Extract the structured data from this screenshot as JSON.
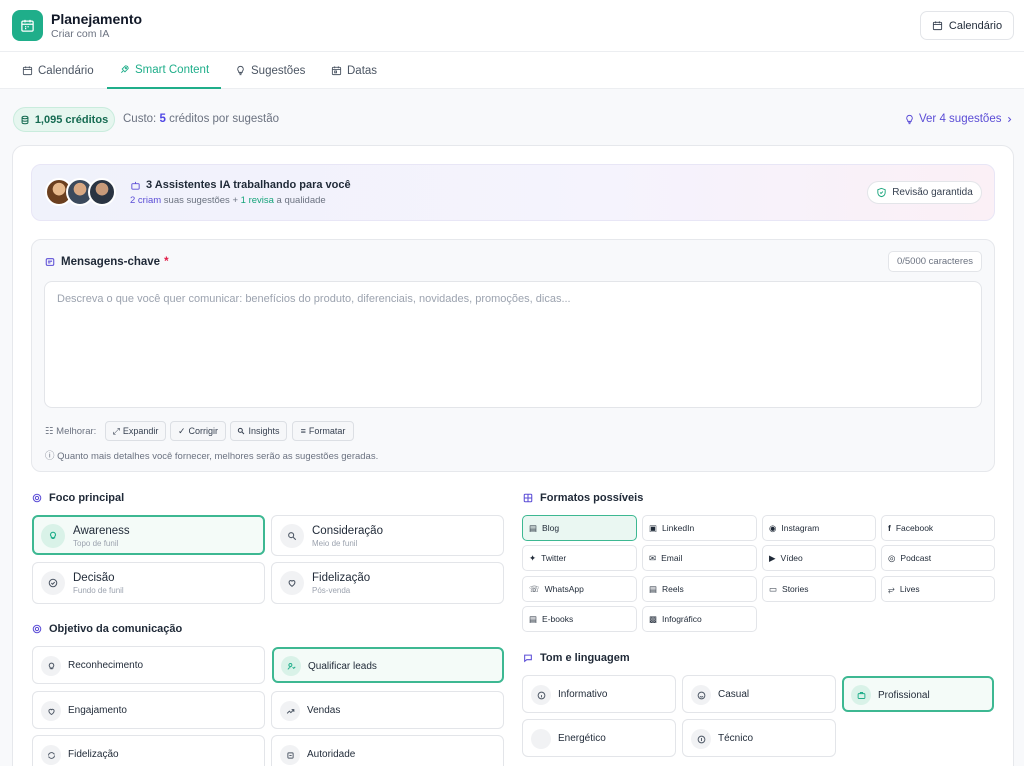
{
  "header": {
    "title": "Planejamento",
    "subtitle": "Criar com IA",
    "calendar_button": "Calendário"
  },
  "tabs": [
    {
      "label": "Calendário",
      "icon": "calendar-icon"
    },
    {
      "label": "Smart Content",
      "icon": "rocket-icon",
      "active": true
    },
    {
      "label": "Sugestões",
      "icon": "lightbulb-icon"
    },
    {
      "label": "Datas",
      "icon": "calendar-date-icon"
    }
  ],
  "toolbar": {
    "credits": "1,095 créditos",
    "cost_prefix": "Custo:",
    "cost_value": "5",
    "cost_suffix": "créditos por sugestão",
    "see_suggestions": "Ver 4 sugestões"
  },
  "banner": {
    "title": "3 Assistentes IA trabalhando para você",
    "create_count": "2 criam",
    "create_text": "suas sugestões +",
    "review_count": "1 revisa",
    "review_text": "a qualidade",
    "badge": "Revisão garantida"
  },
  "messages": {
    "title": "Mensagens-chave",
    "required_mark": "*",
    "counter": "0/5000 caracteres",
    "placeholder": "Descreva o que você quer comunicar: benefícios do produto, diferenciais, novidades, promoções, dicas...",
    "value": "",
    "improve_label": "Melhorar:",
    "improve_actions": [
      "Expandir",
      "Corrigir",
      "Insights",
      "Formatar"
    ],
    "hint": "Quanto mais detalhes você fornecer, melhores serão as sugestões geradas."
  },
  "focus": {
    "title": "Foco principal",
    "options": [
      {
        "title": "Awareness",
        "subtitle": "Topo de funil",
        "icon": "lightbulb-icon",
        "selected": true
      },
      {
        "title": "Consideração",
        "subtitle": "Meio de funil",
        "icon": "search-icon",
        "selected": false
      },
      {
        "title": "Decisão",
        "subtitle": "Fundo de funil",
        "icon": "check-circle-icon",
        "selected": false
      },
      {
        "title": "Fidelização",
        "subtitle": "Pós-venda",
        "icon": "heart-icon",
        "selected": false
      }
    ]
  },
  "objective": {
    "title": "Objetivo da comunicação",
    "options": [
      {
        "label": "Reconhecimento",
        "icon": "lightbulb-icon",
        "selected": false
      },
      {
        "label": "Qualificar leads",
        "icon": "user-filter-icon",
        "selected": true
      },
      {
        "label": "Engajamento",
        "icon": "heart-icon",
        "selected": false
      },
      {
        "label": "Vendas",
        "icon": "trending-up-icon",
        "selected": false
      },
      {
        "label": "Fidelização",
        "icon": "refresh-icon",
        "selected": false
      },
      {
        "label": "Autoridade",
        "icon": "award-icon",
        "selected": false
      }
    ]
  },
  "formats": {
    "title": "Formatos possíveis",
    "options": [
      {
        "label": "Blog",
        "icon": "blog-icon",
        "selected": true
      },
      {
        "label": "LinkedIn",
        "icon": "linkedin-icon",
        "selected": false
      },
      {
        "label": "Instagram",
        "icon": "instagram-icon",
        "selected": false
      },
      {
        "label": "Facebook",
        "icon": "facebook-icon",
        "selected": false
      },
      {
        "label": "Twitter",
        "icon": "twitter-icon",
        "selected": false
      },
      {
        "label": "Email",
        "icon": "mail-icon",
        "selected": false
      },
      {
        "label": "Vídeo",
        "icon": "video-icon",
        "selected": false
      },
      {
        "label": "Podcast",
        "icon": "podcast-icon",
        "selected": false
      },
      {
        "label": "WhatsApp",
        "icon": "whatsapp-icon",
        "selected": false
      },
      {
        "label": "Reels",
        "icon": "reels-icon",
        "selected": false
      },
      {
        "label": "Stories",
        "icon": "stories-icon",
        "selected": false
      },
      {
        "label": "Lives",
        "icon": "broadcast-icon",
        "selected": false
      },
      {
        "label": "E-books",
        "icon": "book-icon",
        "selected": false
      },
      {
        "label": "Infográfico",
        "icon": "infographic-icon",
        "selected": false
      }
    ]
  },
  "tone": {
    "title": "Tom e linguagem",
    "options": [
      {
        "label": "Informativo",
        "icon": "info-icon",
        "selected": false
      },
      {
        "label": "Casual",
        "icon": "smile-icon",
        "selected": false
      },
      {
        "label": "Profissional",
        "icon": "briefcase-icon",
        "selected": true
      },
      {
        "label": "Energético",
        "icon": "zap-icon",
        "selected": false
      },
      {
        "label": "Técnico",
        "icon": "settings-icon",
        "selected": false
      }
    ]
  },
  "colors": {
    "accent": "#1fae8a",
    "indigo": "#5b4dd6",
    "selected_border": "#3db892"
  }
}
